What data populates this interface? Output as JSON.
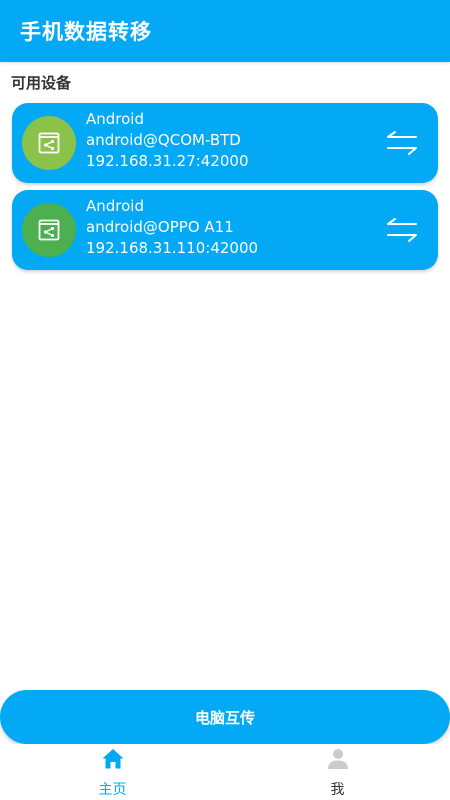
{
  "app_bar": {
    "title": "手机数据转移"
  },
  "section": {
    "label": "可用设备"
  },
  "devices": [
    {
      "name": "Android",
      "account": "android@QCOM-BTD",
      "address": "192.168.31.27:42000",
      "icon": "share-screen-icon",
      "icon_bg": "#8bc34a"
    },
    {
      "name": "Android",
      "account": "android@OPPO A11",
      "address": "192.168.31.110:42000",
      "icon": "share-screen-icon",
      "icon_bg": "#4caf50"
    }
  ],
  "pc_transfer_button": {
    "label": "电脑互传"
  },
  "bottom_nav": {
    "items": [
      {
        "label": "主页",
        "icon": "home-icon",
        "active": true
      },
      {
        "label": "我",
        "icon": "person-icon",
        "active": false
      }
    ]
  },
  "colors": {
    "primary": "#03a9f4",
    "inactive_icon": "#cccccc",
    "section_text": "#333333"
  }
}
